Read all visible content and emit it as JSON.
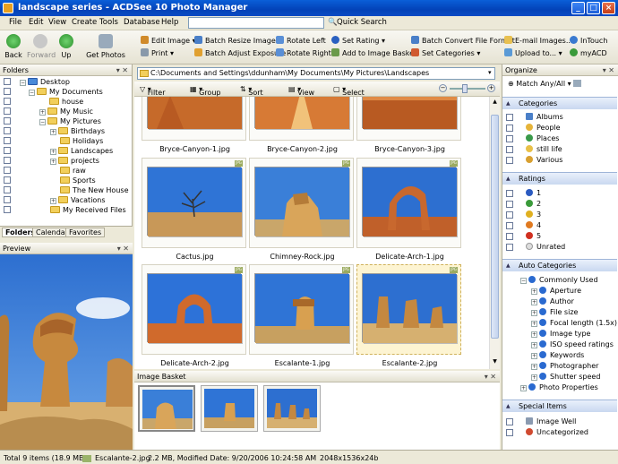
{
  "window": {
    "title": "landscape series - ACDSee 10 Photo Manager"
  },
  "menu": [
    "File",
    "Edit",
    "View",
    "Create",
    "Tools",
    "Database",
    "Help"
  ],
  "quick_search": {
    "label": "Quick Search"
  },
  "toolbar": {
    "back": "Back",
    "forward": "Forward",
    "up": "Up",
    "get_photos": "Get Photos",
    "edit_image": "Edit Image",
    "print": "Print",
    "batch_resize": "Batch Resize Images",
    "batch_adjust": "Batch Adjust Exposure",
    "rotate_left": "Rotate Left",
    "rotate_right": "Rotate Right",
    "set_rating": "Set Rating",
    "add_basket": "Add to Image Basket",
    "batch_convert": "Batch Convert File Format",
    "set_categories": "Set Categories",
    "email": "E-mail Images...",
    "upload": "Upload to...",
    "intouch": "InTouch",
    "myacd": "myACD"
  },
  "folders": {
    "title": "Folders",
    "items": [
      "Desktop",
      "My Documents",
      "house",
      "My Music",
      "My Pictures",
      "Birthdays",
      "Holidays",
      "Landscapes",
      "projects",
      "raw",
      "Sports",
      "The New House",
      "Vacations",
      "My Received Files"
    ],
    "tabs": [
      "Folders",
      "Calendar",
      "Favorites"
    ]
  },
  "preview": {
    "title": "Preview"
  },
  "address": {
    "path": "C:\\Documents and Settings\\ddunham\\My Documents\\My Pictures\\Landscapes"
  },
  "filterbar": {
    "filter": "Filter By",
    "group": "Group By",
    "sort": "Sort By",
    "view": "View",
    "select": "Select"
  },
  "thumbnails": [
    {
      "name": "Bryce-Canyon-1.jpg"
    },
    {
      "name": "Bryce-Canyon-2.jpg"
    },
    {
      "name": "Bryce-Canyon-3.jpg"
    },
    {
      "name": "Cactus.jpg",
      "tag": "JPG"
    },
    {
      "name": "Chimney-Rock.jpg",
      "tag": "JPG"
    },
    {
      "name": "Delicate-Arch-1.jpg",
      "tag": "JPG"
    },
    {
      "name": "Delicate-Arch-2.jpg",
      "tag": "JPG"
    },
    {
      "name": "Escalante-1.jpg",
      "tag": "JPG"
    },
    {
      "name": "Escalante-2.jpg",
      "tag": "JPG",
      "selected": true
    }
  ],
  "basket": {
    "title": "Image Basket"
  },
  "organize": {
    "title": "Organize",
    "match": "Match Any/All",
    "categories_title": "Categories",
    "categories": [
      "Albums",
      "People",
      "Places",
      "still life",
      "Various"
    ],
    "ratings_title": "Ratings",
    "ratings": [
      "1",
      "2",
      "3",
      "4",
      "5",
      "Unrated"
    ],
    "auto_title": "Auto Categories",
    "auto": [
      "Commonly Used",
      "Aperture",
      "Author",
      "File size",
      "Focal length (1.5x)",
      "Image type",
      "ISO speed ratings",
      "Keywords",
      "Photographer",
      "Shutter speed",
      "Photo Properties"
    ],
    "special_title": "Special Items",
    "special": [
      "Image Well",
      "Uncategorized"
    ]
  },
  "status": {
    "total": "Total 9 items  (18.9 MB)",
    "file": "Escalante-2.jpg",
    "info": "2.2 MB, Modified Date: 9/20/2006 10:24:58 AM",
    "dims": "2048x1536x24b"
  },
  "colors": {
    "titlebar": "#0a5fd8",
    "organize_header": "#c9d8f0",
    "selection": "#fdf4d2"
  }
}
